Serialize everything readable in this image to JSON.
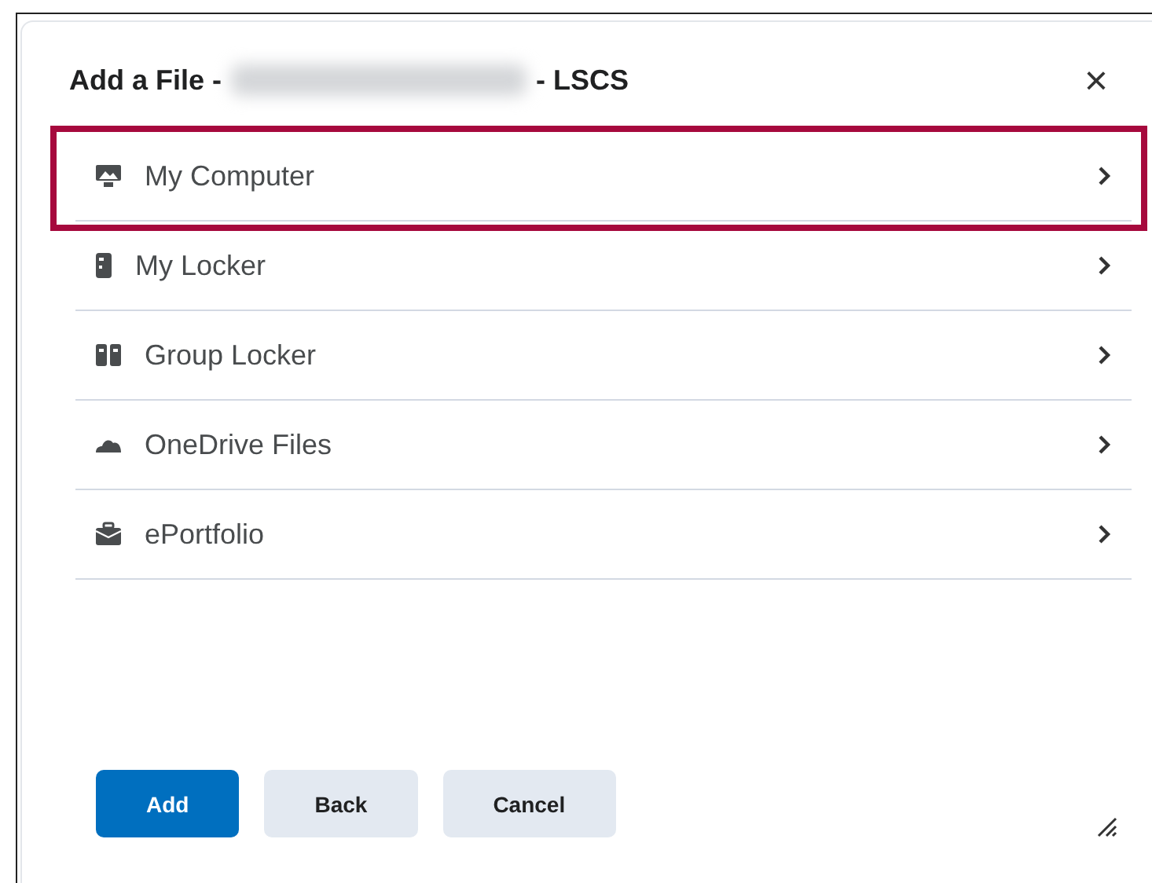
{
  "dialog": {
    "title_prefix": "Add a File -",
    "title_redacted": true,
    "title_suffix": "- LSCS",
    "close": "×"
  },
  "sources": [
    {
      "kind": "computer",
      "label": "My Computer",
      "highlighted": true
    },
    {
      "kind": "locker",
      "label": "My Locker",
      "highlighted": false
    },
    {
      "kind": "group",
      "label": "Group Locker",
      "highlighted": false
    },
    {
      "kind": "cloud",
      "label": "OneDrive Files",
      "highlighted": false
    },
    {
      "kind": "portfolio",
      "label": "ePortfolio",
      "highlighted": false
    }
  ],
  "buttons": [
    {
      "kind": "primary",
      "label": "Add"
    },
    {
      "kind": "secondary",
      "label": "Back"
    },
    {
      "kind": "secondary",
      "label": "Cancel"
    }
  ]
}
